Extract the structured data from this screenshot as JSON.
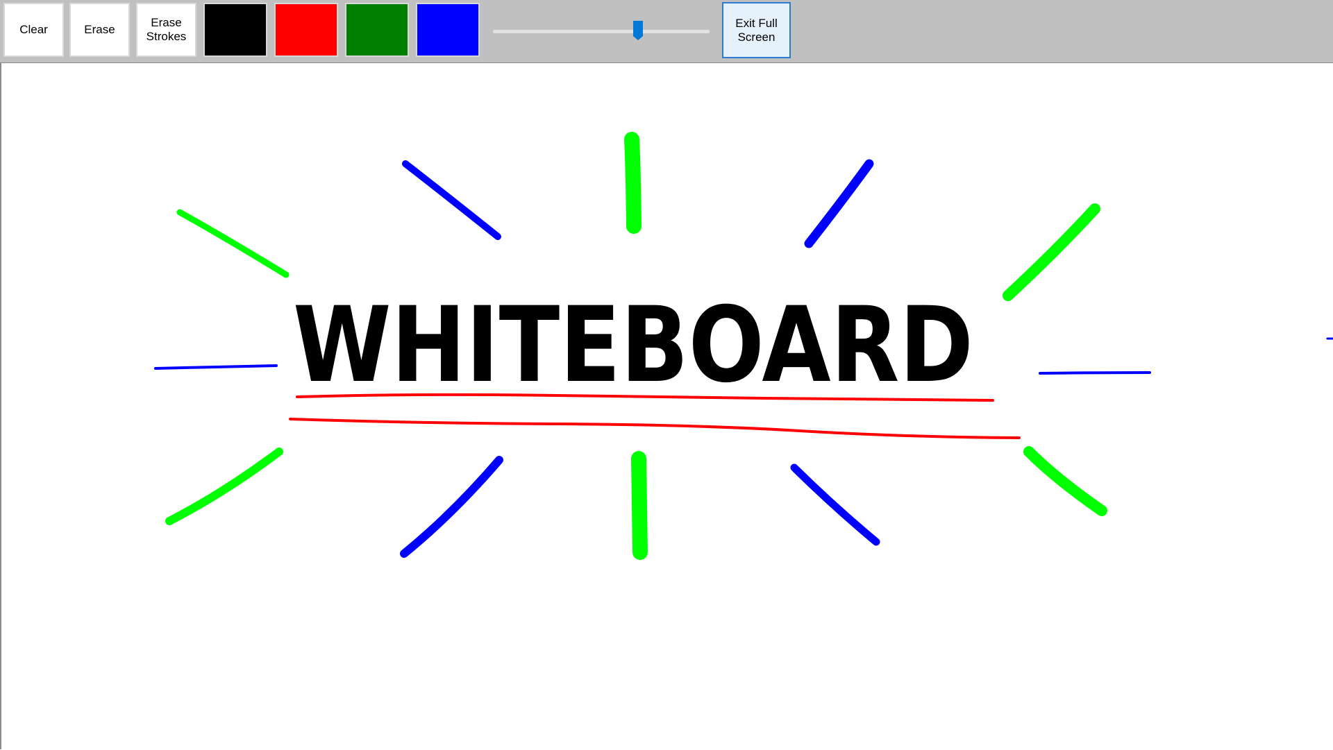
{
  "toolbar": {
    "clear_label": "Clear",
    "erase_label": "Erase",
    "erase_strokes_label": "Erase\nStrokes",
    "exit_fullscreen_label": "Exit Full\nScreen",
    "colors": [
      {
        "name": "black",
        "hex": "#000000"
      },
      {
        "name": "red",
        "hex": "#ff0000"
      },
      {
        "name": "green",
        "hex": "#008000"
      },
      {
        "name": "blue",
        "hex": "#0000ff"
      }
    ],
    "brush_size_level": 0.67,
    "accent_color": "#0078d7"
  },
  "canvas": {
    "handwritten_text": "WHITEBOARD",
    "ink_colors": {
      "text": "#000000",
      "underline": "#ff0000",
      "rays_green": "#00ff00",
      "rays_blue": "#0000ff"
    }
  }
}
